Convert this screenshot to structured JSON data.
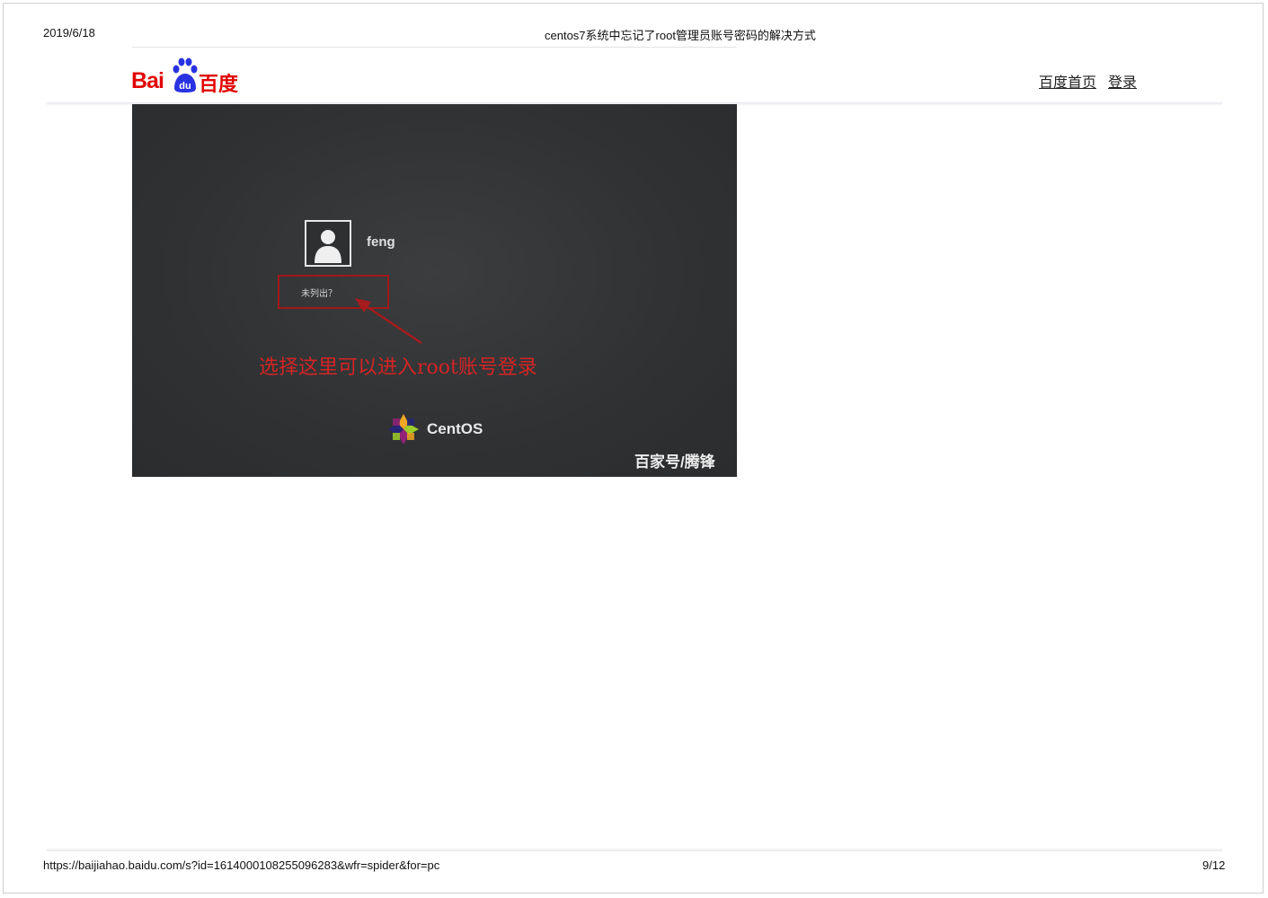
{
  "print_header": {
    "date": "2019/6/18",
    "title": "centos7系统中忘记了root管理员账号密码的解决方式"
  },
  "site_header": {
    "logo_latin": "Bai",
    "logo_du": "du",
    "logo_chinese": "百度",
    "nav_home": "百度首页",
    "nav_login": "登录",
    "brand_red": "#e10601",
    "paw_blue": "#2932e1"
  },
  "article_image": {
    "username": "feng",
    "not_listed_label": "未列出？",
    "annotation": "选择这里可以进入root账号登录",
    "distro_name": "CentOS",
    "watermark": "百家号/腾锋",
    "annotation_color": "#d22525"
  },
  "print_footer": {
    "url": "https://baijiahao.baidu.com/s?id=1614000108255096283&wfr=spider&for=pc",
    "page": "9/12"
  }
}
